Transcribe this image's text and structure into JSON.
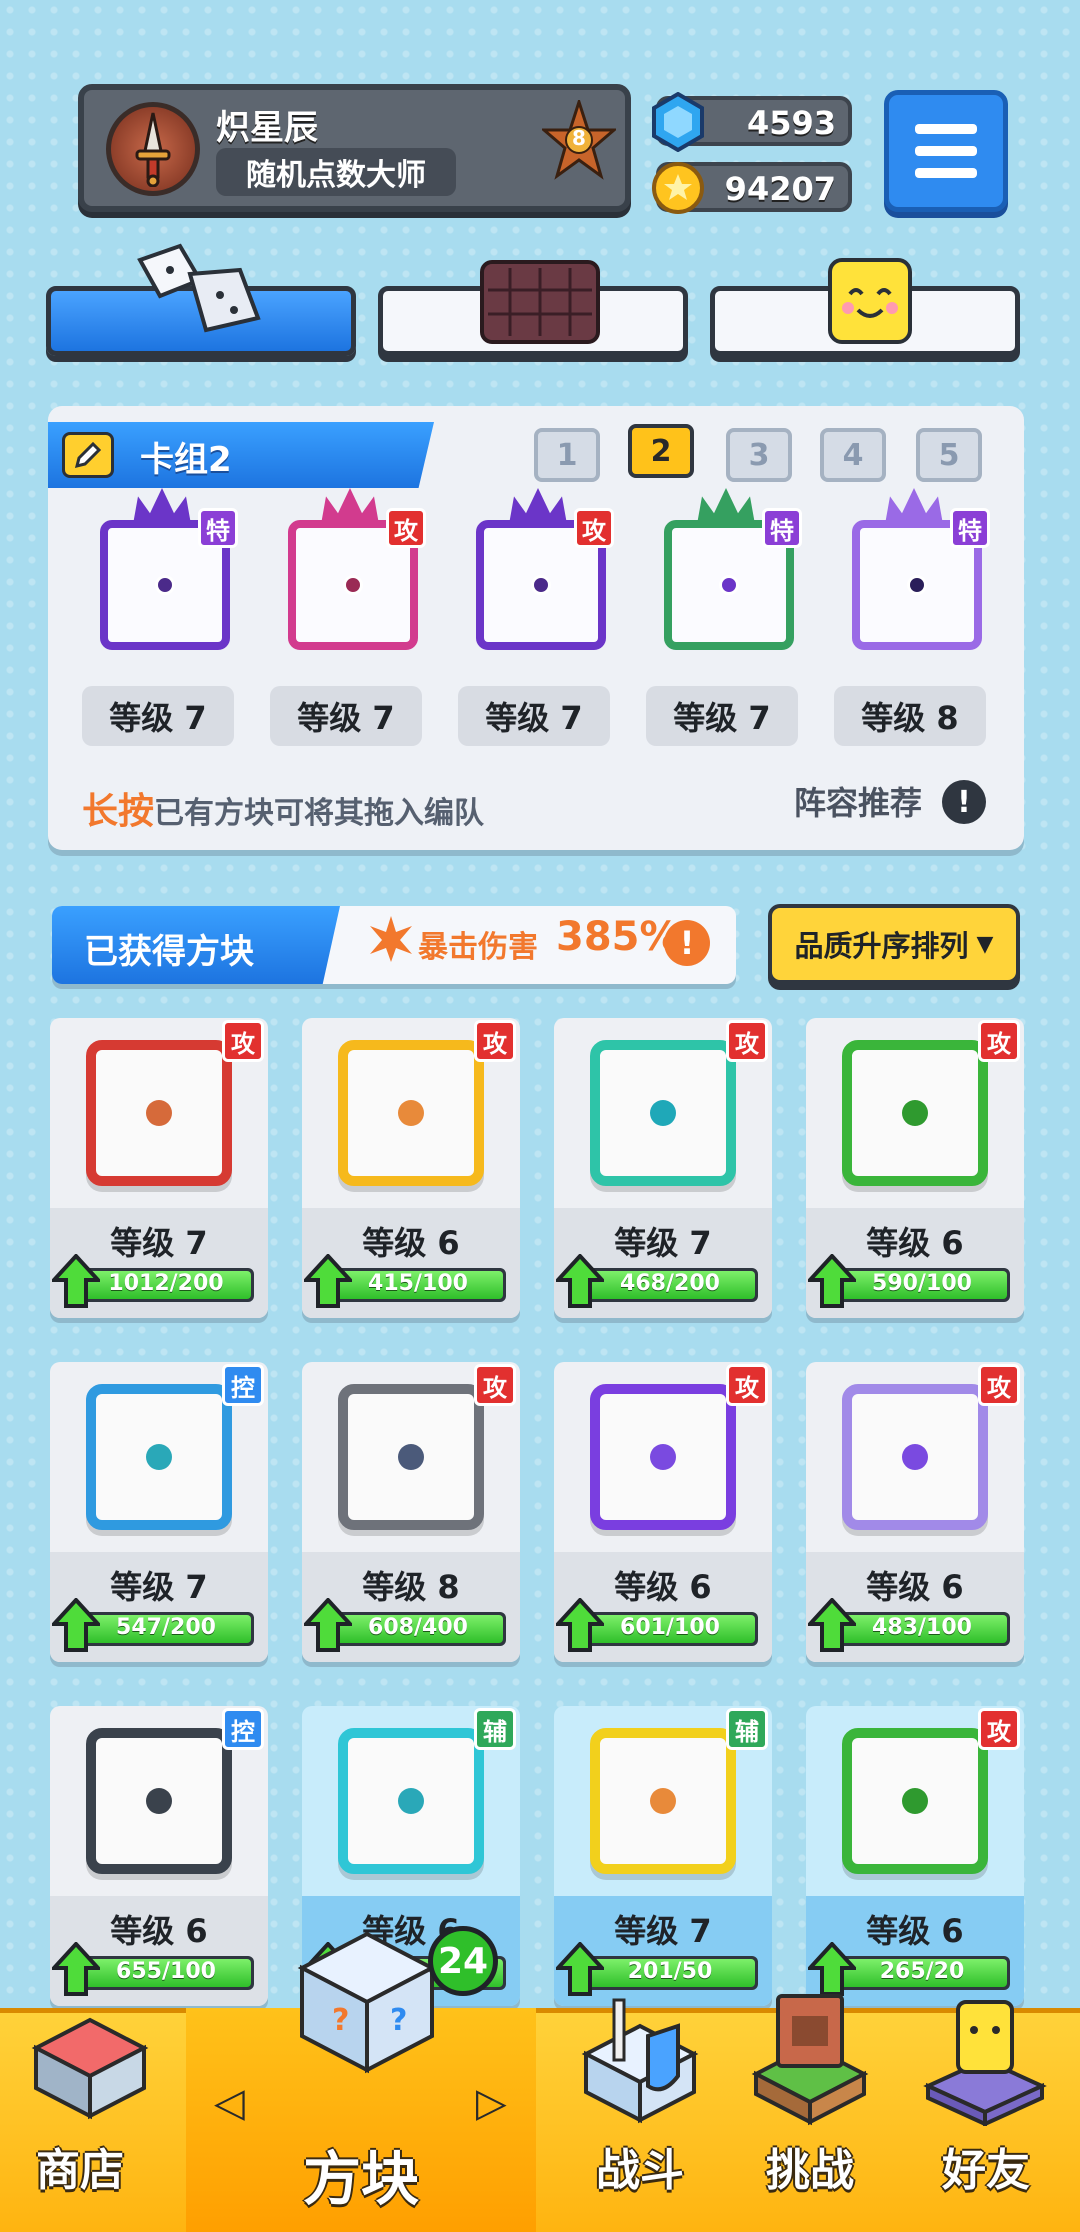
{
  "profile": {
    "name": "炽星辰",
    "title": "随机点数大师",
    "rank": "8"
  },
  "currency": {
    "gems": "4593",
    "coins": "94207"
  },
  "deck": {
    "label": "卡组2",
    "slots": [
      "1",
      "2",
      "3",
      "4",
      "5"
    ],
    "active_slot": "2",
    "cards": [
      {
        "tag": "特",
        "level": "等级 7",
        "color": "#6b35c8",
        "dot": "#4b2a8a"
      },
      {
        "tag": "攻",
        "level": "等级 7",
        "color": "#d23b8e",
        "dot": "#9a2a55"
      },
      {
        "tag": "攻",
        "level": "等级 7",
        "color": "#6b35c8",
        "dot": "#4b2a8a"
      },
      {
        "tag": "特",
        "level": "等级 7",
        "color": "#35a060",
        "dot": "#6b35c8"
      },
      {
        "tag": "特",
        "level": "等级 8",
        "color": "#9a6ae6",
        "dot": "#2a1e5a"
      }
    ],
    "hint_highlight": "长按",
    "hint_text": "已有方块可将其拖入编队",
    "recommend": "阵容推荐"
  },
  "owned": {
    "label": "已获得方块",
    "crit_label": "暴击伤害",
    "crit_value": "385%",
    "sort_label": "品质升序排列"
  },
  "blocks": [
    {
      "tag": "攻",
      "tag_color": "#e2302f",
      "level": "等级 7",
      "progress": "1012/200",
      "frame": "#d63a32",
      "dot": "#d66a3a",
      "fill": 1.0,
      "blue": false
    },
    {
      "tag": "攻",
      "tag_color": "#e2302f",
      "level": "等级 6",
      "progress": "415/100",
      "frame": "#f6b91c",
      "dot": "#e88a3a",
      "fill": 1.0,
      "blue": false
    },
    {
      "tag": "攻",
      "tag_color": "#e2302f",
      "level": "等级 7",
      "progress": "468/200",
      "frame": "#2ec4a8",
      "dot": "#1fa8b8",
      "fill": 1.0,
      "blue": false
    },
    {
      "tag": "攻",
      "tag_color": "#e2302f",
      "level": "等级 6",
      "progress": "590/100",
      "frame": "#3ab53a",
      "dot": "#2f9a2f",
      "fill": 1.0,
      "blue": false
    },
    {
      "tag": "控",
      "tag_color": "#2f8bf0",
      "level": "等级 7",
      "progress": "547/200",
      "frame": "#2f9ae0",
      "dot": "#2aa8b8",
      "fill": 1.0,
      "blue": false
    },
    {
      "tag": "攻",
      "tag_color": "#e2302f",
      "level": "等级 8",
      "progress": "608/400",
      "frame": "#6e727a",
      "dot": "#4b5a7a",
      "fill": 1.0,
      "blue": false
    },
    {
      "tag": "攻",
      "tag_color": "#e2302f",
      "level": "等级 6",
      "progress": "601/100",
      "frame": "#7a3ee0",
      "dot": "#7a4ae0",
      "fill": 1.0,
      "blue": false
    },
    {
      "tag": "攻",
      "tag_color": "#e2302f",
      "level": "等级 6",
      "progress": "483/100",
      "frame": "#a18ae8",
      "dot": "#7a4ae0",
      "fill": 1.0,
      "blue": false
    },
    {
      "tag": "控",
      "tag_color": "#2f8bf0",
      "level": "等级 6",
      "progress": "655/100",
      "frame": "#3a424c",
      "dot": "#3a424c",
      "fill": 1.0,
      "blue": false
    },
    {
      "tag": "辅",
      "tag_color": "#2fa85a",
      "level": "等级 6",
      "progress": "",
      "frame": "#2fc6d6",
      "dot": "#2aa8b8",
      "fill": 1.0,
      "blue": true
    },
    {
      "tag": "辅",
      "tag_color": "#2fa85a",
      "level": "等级 7",
      "progress": "201/50",
      "frame": "#f2d01c",
      "dot": "#e88a3a",
      "fill": 1.0,
      "blue": true
    },
    {
      "tag": "攻",
      "tag_color": "#e2302f",
      "level": "等级 6",
      "progress": "265/20",
      "frame": "#3ab53a",
      "dot": "#2f9a2f",
      "fill": 1.0,
      "blue": true
    }
  ],
  "nav": {
    "shop": "商店",
    "blocks": "方块",
    "battle": "战斗",
    "challenge": "挑战",
    "friends": "好友",
    "blocks_badge": "24"
  }
}
